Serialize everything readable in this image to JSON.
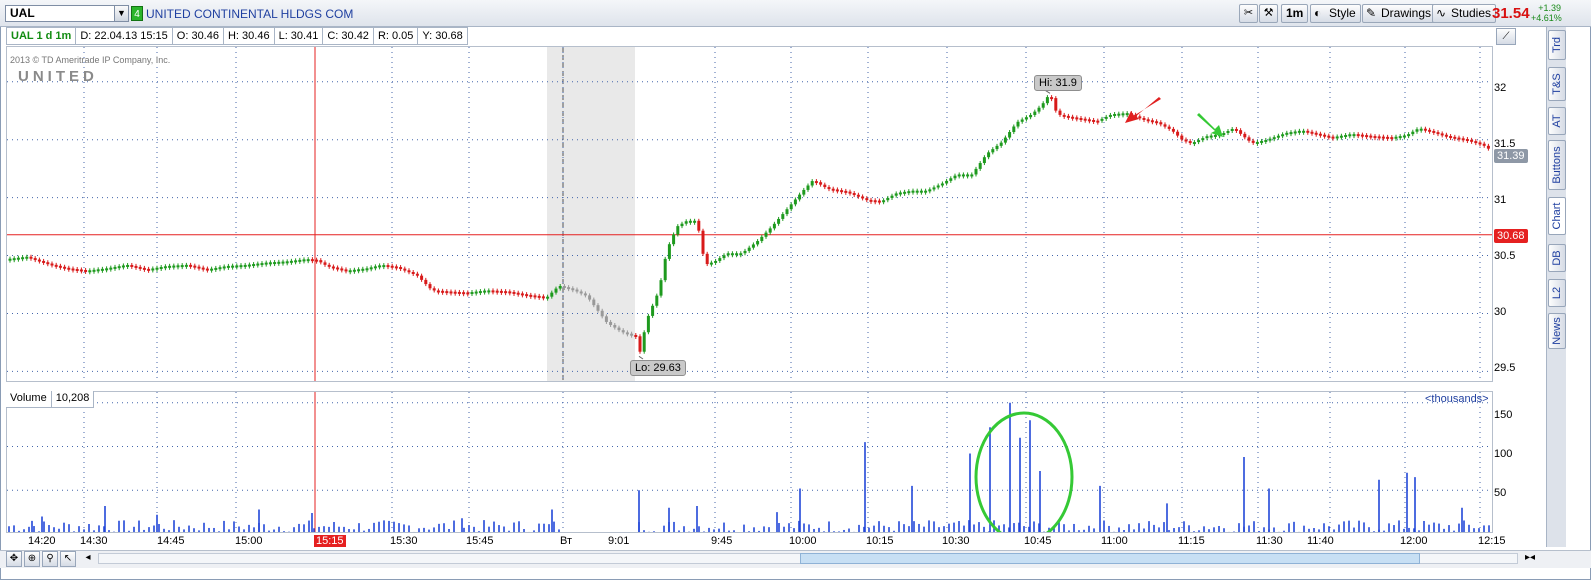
{
  "toolbar": {
    "symbol": "UAL",
    "link_badge": "4",
    "company": "UNITED CONTINENTAL HLDGS COM",
    "timeframe_btn": "1m",
    "style_btn": "Style",
    "drawings_btn": "Drawings",
    "studies_btn": "Studies",
    "last_price": "31.54",
    "change_abs": "+1.39",
    "change_pct": "+4.61%"
  },
  "info": {
    "chart_id": "UAL 1 d 1m",
    "date": "D: 22.04.13 15:15",
    "open": "O: 30.46",
    "high": "H: 30.46",
    "low": "L: 30.41",
    "close": "C: 30.42",
    "range": "R: 0.05",
    "y": "Y: 30.68"
  },
  "watermark": {
    "copyright": "2013 © TD Ameritrade IP Company, Inc.",
    "logo": "UNITED"
  },
  "price_axis": {
    "ticks": [
      "32",
      "31.5",
      "31",
      "30.5",
      "30",
      "29.5"
    ],
    "current_tag": "31.39",
    "ref_tag": "30.68"
  },
  "annotations": {
    "hi": "Hi: 31.9",
    "lo": "Lo: 29.63"
  },
  "volume": {
    "label": "Volume",
    "value": "10,208",
    "units": "<thousands>",
    "ticks": [
      "150",
      "100",
      "50"
    ]
  },
  "time_axis": {
    "labels": [
      "14:20",
      "14:30",
      "14:45",
      "15:00",
      "15:15",
      "15:30",
      "15:45",
      "Вт",
      "9:01",
      "9:45",
      "10:00",
      "10:15",
      "10:30",
      "10:45",
      "11:00",
      "11:15",
      "11:30",
      "11:40",
      "12:00",
      "12:15"
    ],
    "highlight": "15:15"
  },
  "side_tabs": [
    "Trd",
    "T&S",
    "AT",
    "Buttons",
    "Chart",
    "DB",
    "L2",
    "News"
  ],
  "colors": {
    "up": "#1e9a1e",
    "down": "#d81a1a",
    "volume": "#2247d8",
    "ref_line": "#e52020",
    "circle": "#35c935"
  },
  "chart_data": {
    "type": "candlestick",
    "symbol": "UAL",
    "interval": "1m",
    "ylim": [
      29.4,
      32.3
    ],
    "reference_line": 30.68,
    "high": 31.9,
    "low": 29.63,
    "close_path": [
      [
        0,
        30.47
      ],
      [
        10,
        30.48
      ],
      [
        20,
        30.49
      ],
      [
        30,
        30.46
      ],
      [
        45,
        30.42
      ],
      [
        60,
        30.39
      ],
      [
        80,
        30.37
      ],
      [
        100,
        30.39
      ],
      [
        120,
        30.42
      ],
      [
        140,
        30.38
      ],
      [
        160,
        30.41
      ],
      [
        180,
        30.42
      ],
      [
        200,
        30.38
      ],
      [
        220,
        30.41
      ],
      [
        240,
        30.42
      ],
      [
        260,
        30.44
      ],
      [
        280,
        30.45
      ],
      [
        300,
        30.47
      ],
      [
        310,
        30.46
      ],
      [
        320,
        30.41
      ],
      [
        340,
        30.37
      ],
      [
        360,
        30.39
      ],
      [
        375,
        30.42
      ],
      [
        390,
        30.4
      ],
      [
        410,
        30.33
      ],
      [
        425,
        30.2
      ],
      [
        440,
        30.19
      ],
      [
        460,
        30.18
      ],
      [
        480,
        30.2
      ],
      [
        500,
        30.19
      ],
      [
        520,
        30.16
      ],
      [
        540,
        30.14
      ],
      [
        552,
        30.24
      ],
      [
        565,
        30.21
      ],
      [
        580,
        30.15
      ],
      [
        600,
        29.92
      ],
      [
        615,
        29.84
      ],
      [
        630,
        29.8
      ],
      [
        632,
        29.63
      ],
      [
        640,
        29.95
      ],
      [
        652,
        30.2
      ],
      [
        660,
        30.55
      ],
      [
        670,
        30.75
      ],
      [
        680,
        30.8
      ],
      [
        690,
        30.8
      ],
      [
        698,
        30.42
      ],
      [
        708,
        30.45
      ],
      [
        720,
        30.52
      ],
      [
        735,
        30.52
      ],
      [
        750,
        30.62
      ],
      [
        765,
        30.75
      ],
      [
        780,
        30.9
      ],
      [
        795,
        31.05
      ],
      [
        806,
        31.15
      ],
      [
        820,
        31.08
      ],
      [
        840,
        31.05
      ],
      [
        860,
        30.98
      ],
      [
        875,
        30.97
      ],
      [
        890,
        31.04
      ],
      [
        905,
        31.06
      ],
      [
        920,
        31.06
      ],
      [
        935,
        31.12
      ],
      [
        950,
        31.2
      ],
      [
        965,
        31.2
      ],
      [
        980,
        31.38
      ],
      [
        995,
        31.48
      ],
      [
        1010,
        31.65
      ],
      [
        1025,
        31.72
      ],
      [
        1035,
        31.8
      ],
      [
        1043,
        31.9
      ],
      [
        1050,
        31.72
      ],
      [
        1060,
        31.7
      ],
      [
        1075,
        31.68
      ],
      [
        1090,
        31.66
      ],
      [
        1105,
        31.72
      ],
      [
        1120,
        31.73
      ],
      [
        1135,
        31.68
      ],
      [
        1150,
        31.65
      ],
      [
        1165,
        31.58
      ],
      [
        1175,
        31.5
      ],
      [
        1185,
        31.47
      ],
      [
        1200,
        31.53
      ],
      [
        1215,
        31.55
      ],
      [
        1227,
        31.6
      ],
      [
        1235,
        31.54
      ],
      [
        1245,
        31.47
      ],
      [
        1260,
        31.5
      ],
      [
        1280,
        31.56
      ],
      [
        1295,
        31.58
      ],
      [
        1310,
        31.55
      ],
      [
        1325,
        31.52
      ],
      [
        1345,
        31.55
      ],
      [
        1365,
        31.53
      ],
      [
        1385,
        31.52
      ],
      [
        1400,
        31.54
      ],
      [
        1412,
        31.6
      ],
      [
        1425,
        31.57
      ],
      [
        1440,
        31.53
      ],
      [
        1460,
        31.5
      ],
      [
        1475,
        31.46
      ],
      [
        1487,
        31.39
      ]
    ],
    "volume_spikes_thousands": [
      [
        25,
        15
      ],
      [
        35,
        20
      ],
      [
        98,
        32
      ],
      [
        150,
        22
      ],
      [
        252,
        28
      ],
      [
        305,
        24
      ],
      [
        455,
        18
      ],
      [
        545,
        28
      ],
      [
        632,
        50
      ],
      [
        662,
        30
      ],
      [
        690,
        32
      ],
      [
        770,
        25
      ],
      [
        793,
        52
      ],
      [
        858,
        105
      ],
      [
        905,
        55
      ],
      [
        963,
        92
      ],
      [
        983,
        122
      ],
      [
        1003,
        150
      ],
      [
        1013,
        110
      ],
      [
        1023,
        130
      ],
      [
        1033,
        72
      ],
      [
        1093,
        55
      ],
      [
        1160,
        35
      ],
      [
        1237,
        88
      ],
      [
        1262,
        52
      ],
      [
        1372,
        62
      ],
      [
        1400,
        70
      ],
      [
        1408,
        65
      ],
      [
        1455,
        30
      ]
    ],
    "xlabel": "",
    "ylabel": ""
  }
}
